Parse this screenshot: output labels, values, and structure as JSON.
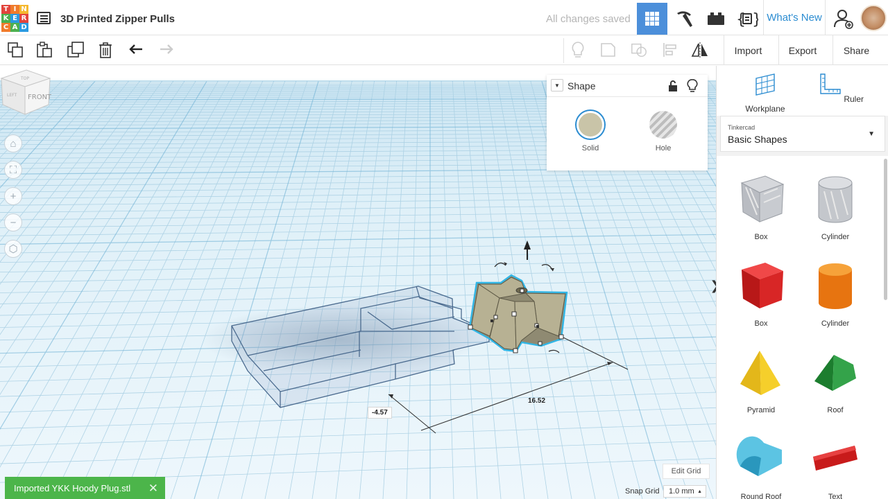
{
  "app": {
    "logo_letters": [
      "T",
      "I",
      "N",
      "K",
      "E",
      "R",
      "C",
      "A",
      "D"
    ],
    "logo_colors": [
      "#e2443c",
      "#f07b2b",
      "#f5b82e",
      "#4cb050",
      "#2b9ae0",
      "#e2443c",
      "#f07b2b",
      "#4cb050",
      "#2b9ae0"
    ],
    "project_title": "3D Printed Zipper Pulls",
    "save_status": "All changes saved",
    "whats_new": "What's New"
  },
  "toolbar": {
    "import": "Import",
    "export": "Export",
    "share": "Share"
  },
  "inspector": {
    "title": "Shape",
    "solid_label": "Solid",
    "hole_label": "Hole",
    "solid_color": "#c9c4a8"
  },
  "right_panel": {
    "workplane_label": "Workplane",
    "ruler_label": "Ruler",
    "category_small": "Tinkercad",
    "category_value": "Basic Shapes",
    "shapes": [
      {
        "label": "Box",
        "icon": "box-hole-icon"
      },
      {
        "label": "Cylinder",
        "icon": "cylinder-hole-icon"
      },
      {
        "label": "Box",
        "icon": "box-red-icon"
      },
      {
        "label": "Cylinder",
        "icon": "cylinder-orange-icon"
      },
      {
        "label": "Pyramid",
        "icon": "pyramid-icon"
      },
      {
        "label": "Roof",
        "icon": "roof-icon"
      },
      {
        "label": "Round Roof",
        "icon": "round-roof-icon"
      },
      {
        "label": "Text",
        "icon": "text-shape-icon"
      }
    ]
  },
  "viewport": {
    "view_cube_top": "TOP",
    "view_cube_front": "FRONT",
    "view_cube_left": "LEFT",
    "dim_x": "-4.57",
    "dim_len": "16.52"
  },
  "bottom": {
    "toast": "Imported YKK Hoody Plug.stl",
    "edit_grid": "Edit Grid",
    "snap_label": "Snap Grid",
    "snap_value": "1.0 mm"
  },
  "colors": {
    "accent_blue": "#4c8fda",
    "toast_green": "#4cb54a",
    "link_blue": "#2b8cd1"
  }
}
